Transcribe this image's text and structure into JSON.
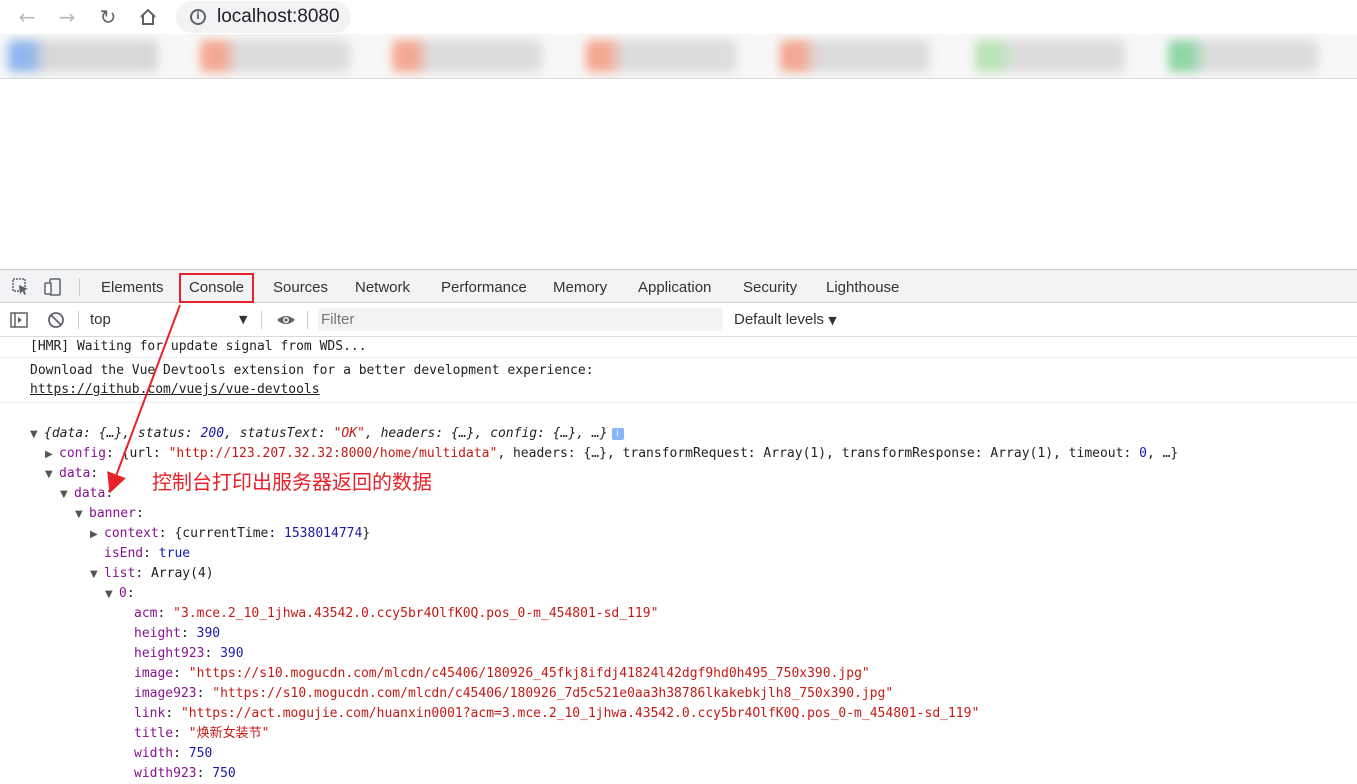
{
  "browser": {
    "url": "localhost:8080",
    "nav_icons": [
      "back-arrow-icon",
      "forward-arrow-icon",
      "reload-icon",
      "home-icon"
    ]
  },
  "devtools": {
    "tabs": [
      "Elements",
      "Console",
      "Sources",
      "Network",
      "Performance",
      "Memory",
      "Application",
      "Security",
      "Lighthouse"
    ],
    "active_tab": "Console",
    "context": "top",
    "filter_placeholder": "Filter",
    "levels": "Default levels"
  },
  "console": {
    "hmr": "[HMR] Waiting for update signal from WDS...",
    "vue_msg": "Download the Vue Devtools extension for a better development experience:",
    "vue_link": "https://github.com/vuejs/vue-devtools",
    "root": {
      "open": "{data: {…}, status: ",
      "status": "200",
      "mid": ", statusText: ",
      "statusText": "\"OK\"",
      "tail": ", headers: {…}, config: {…}, …}",
      "badge": "i"
    },
    "config": {
      "key": "config",
      "p1": ": {url: ",
      "url": "\"http://123.207.32.32:8000/home/multidata\"",
      "p2": ", headers: {…}, transformRequest: Array(1), transformResponse: Array(1), timeout: ",
      "timeout": "0",
      "p3": ", …}"
    },
    "data_key": "data",
    "inner_data_key": "data",
    "banner_key": "banner",
    "context": {
      "key": "context",
      "open": ": {currentTime: ",
      "value": "1538014774",
      "close": "}"
    },
    "isEnd": {
      "key": "isEnd",
      "value": "true"
    },
    "list": {
      "key": "list",
      "value": "Array(4)"
    },
    "item0_key": "0",
    "fields": [
      {
        "key": "acm",
        "value": "\"3.mce.2_10_1jhwa.43542.0.ccy5br4OlfK0Q.pos_0-m_454801-sd_119\"",
        "type": "s"
      },
      {
        "key": "height",
        "value": "390",
        "type": "n"
      },
      {
        "key": "height923",
        "value": "390",
        "type": "n"
      },
      {
        "key": "image",
        "value": "\"https://s10.mogucdn.com/mlcdn/c45406/180926_45fkj8ifdj41824l42dgf9hd0h495_750x390.jpg\"",
        "type": "s"
      },
      {
        "key": "image923",
        "value": "\"https://s10.mogucdn.com/mlcdn/c45406/180926_7d5c521e0aa3h38786lkakebkjlh8_750x390.jpg\"",
        "type": "s"
      },
      {
        "key": "link",
        "value": "\"https://act.mogujie.com/huanxin0001?acm=3.mce.2_10_1jhwa.43542.0.ccy5br4OlfK0Q.pos_0-m_454801-sd_119\"",
        "type": "s"
      },
      {
        "key": "title",
        "value": "\"焕新女装节\"",
        "type": "s"
      },
      {
        "key": "width",
        "value": "750",
        "type": "n"
      },
      {
        "key": "width923",
        "value": "750",
        "type": "n"
      }
    ]
  },
  "annotation": "控制台打印出服务器返回的数据",
  "colors": {
    "annotation_red": "#e8222a",
    "active_tab_underline": "#1a73e8"
  }
}
